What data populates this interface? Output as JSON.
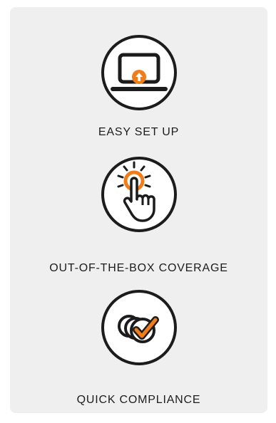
{
  "colors": {
    "background": "#efefef",
    "ink": "#1c1c1c",
    "accent": "#f07d1a",
    "circle_fill": "#ffffff"
  },
  "features": [
    {
      "icon": "monitor-upload-icon",
      "label": "EASY SET UP"
    },
    {
      "icon": "touch-hand-icon",
      "label": "OUT-OF-THE-BOX COVERAGE"
    },
    {
      "icon": "check-stack-icon",
      "label": "QUICK COMPLIANCE"
    }
  ]
}
